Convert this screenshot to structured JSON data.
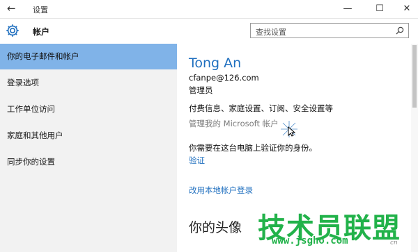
{
  "window": {
    "back_glyph": "←",
    "title": "设置",
    "minimize_glyph": "—",
    "maximize_glyph": "☐",
    "close_glyph": "✕"
  },
  "header": {
    "title": "帐户",
    "icon": "gear-icon",
    "search_placeholder": "查找设置",
    "search_icon": "magnifier-icon"
  },
  "sidebar": {
    "items": [
      {
        "label": "你的电子邮件和帐户",
        "active": true
      },
      {
        "label": "登录选项",
        "active": false
      },
      {
        "label": "工作单位访问",
        "active": false
      },
      {
        "label": "家庭和其他用户",
        "active": false
      },
      {
        "label": "同步你的设置",
        "active": false
      }
    ]
  },
  "account": {
    "name": "Tong An",
    "email": "cfanpe@126.com",
    "role": "管理员",
    "billing_text": "付费信息、家庭设置、订阅、安全设置等",
    "manage_link": "管理我的 Microsoft 帐户",
    "verify_text": "你需要在这台电脑上验证你的身份。",
    "verify_link": "验证",
    "local_link": "改用本地帐户登录",
    "avatar_heading": "你的头像"
  },
  "watermark": {
    "text": "技术员联盟",
    "url": "www.jsgho.com",
    "tag": "cn"
  },
  "colors": {
    "accent": "#1f6fbf",
    "sidebar_active": "#80b3e8",
    "sidebar_bg": "#f2f2f2",
    "watermark": "#22b24a"
  }
}
